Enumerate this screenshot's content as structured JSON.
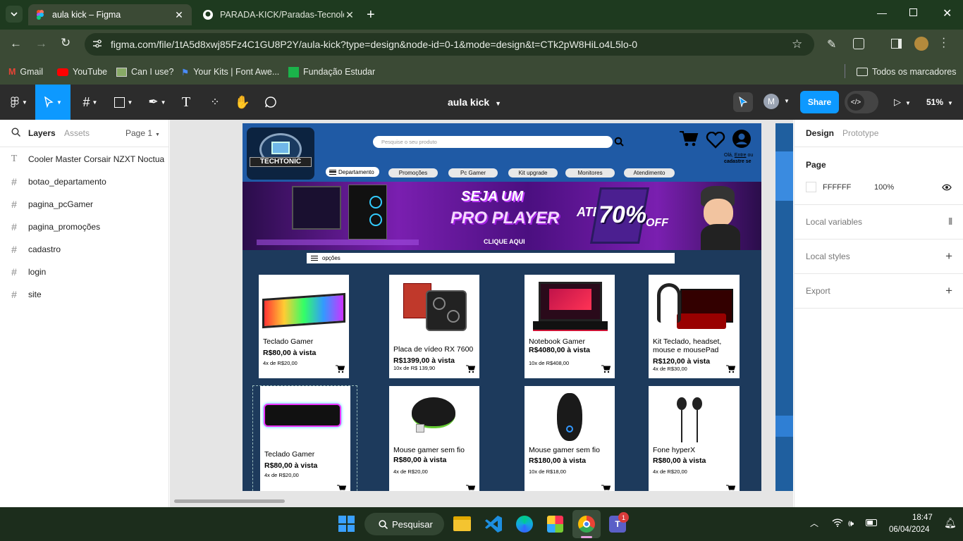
{
  "browser": {
    "tabs": [
      {
        "title": "aula kick – Figma"
      },
      {
        "title": "PARADA-KICK/Paradas-Tecnologi"
      }
    ],
    "url": "figma.com/file/1tA5d8xwj85Fz4C1GU8P2Y/aula-kick?type=design&node-id=0-1&mode=design&t=CTk2pW8HiLo4L5lo-0",
    "bookmarks": [
      "Gmail",
      "YouTube",
      "Can I use?",
      "Your Kits | Font Awe...",
      "Fundação Estudar"
    ],
    "all_bookmarks": "Todos os marcadores"
  },
  "figma": {
    "file_title": "aula kick",
    "avatar_letter": "M",
    "share_label": "Share",
    "zoom": "51%",
    "left_tabs": {
      "layers": "Layers",
      "assets": "Assets",
      "page": "Page 1"
    },
    "layers": [
      "Cooler Master Corsair NZXT Noctua",
      "botao_departamento",
      "pagina_pcGamer",
      "pagina_promoções",
      "cadastro",
      "login",
      "site"
    ],
    "right_tabs": {
      "design": "Design",
      "prototype": "Prototype"
    },
    "page_section": {
      "label": "Page",
      "color": "FFFFFF",
      "opacity": "100%"
    },
    "sections": [
      "Local variables",
      "Local styles",
      "Export"
    ],
    "help": "?"
  },
  "site": {
    "logo_text": "TECHTONIC",
    "search_placeholder": "Pesquise o seu produto",
    "account_text1": "Olá, ",
    "account_link": "Entre",
    "account_text2": " ou",
    "account_text3": "cadastre se",
    "dept_button": "Departamento",
    "nav": [
      "Promoções",
      "Pc Gamer",
      "Kit upgrade",
      "Monitores",
      "Atendimento"
    ],
    "banner": {
      "line1": "SEJA UM",
      "line2": "PRO PLAYER",
      "cta": "CLIQUE AQUI",
      "ate": "ATÉ",
      "pct": "70%",
      "off": "OFF"
    },
    "options_label": "opções",
    "products": [
      {
        "name": "Teclado Gamer",
        "price": "R$80,00 à vista",
        "inst": "4x de R$20,00"
      },
      {
        "name": "Placa de vídeo RX 7600",
        "price": "R$1399,00 à vista",
        "inst": "10x de R$ 139,90"
      },
      {
        "name": "Notebook Gamer",
        "price": "R$4080,00 à vista",
        "inst": "10x de R$408,00"
      },
      {
        "name": "Kit Teclado, headset,",
        "name2": "mouse e mousePad",
        "price": "R$120,00 à vista",
        "inst": "4x de R$30,00"
      },
      {
        "name": "Teclado Gamer",
        "price": "R$80,00 à vista",
        "inst": "4x de R$20,00"
      },
      {
        "name": "Mouse gamer sem fio",
        "price": "R$80,00 à vista",
        "inst": "4x de R$20,00"
      },
      {
        "name": "Mouse gamer sem fio",
        "price": "R$180,00 à vista",
        "inst": "10x de R$18,00"
      },
      {
        "name": "Fone hyperX",
        "price": "R$80,00 à vista",
        "inst": "4x de R$20,00"
      }
    ]
  },
  "taskbar": {
    "search": "Pesquisar",
    "time": "18:47",
    "date": "06/04/2024",
    "badge": "1"
  },
  "colors": {
    "figma_blue": "#0d99ff",
    "site_navy": "#1d3a5c",
    "chrome_green": "#3b4a35"
  }
}
